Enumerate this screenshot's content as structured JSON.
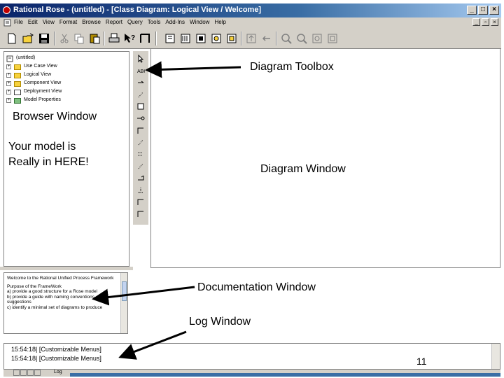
{
  "window": {
    "title": "Rational Rose - (untitled) - [Class Diagram: Logical View / Welcome]",
    "minimize_glyph": "_",
    "maximize_glyph": "□",
    "close_glyph": "×"
  },
  "menubar": {
    "items": [
      "File",
      "Edit",
      "View",
      "Format",
      "Browse",
      "Report",
      "Query",
      "Tools",
      "Add-Ins",
      "Window",
      "Help"
    ],
    "mdi_minimize": "_",
    "mdi_restore": "▫",
    "mdi_close": "×"
  },
  "toolbar": {
    "icons": [
      "new-icon",
      "open-icon",
      "save-icon",
      "cut-icon",
      "copy-icon",
      "paste-icon",
      "print-icon",
      "context-help-icon",
      "browse-class-icon",
      "browse-interaction-icon",
      "browse-component-icon",
      "browse-deployment-icon",
      "browse-parent-icon",
      "browse-previous-icon",
      "zoom-in-icon",
      "zoom-out-icon",
      "fit-window-icon",
      "undo-fit-icon"
    ]
  },
  "browser": {
    "items": [
      {
        "label": "(untitled)",
        "expander": ""
      },
      {
        "label": "Use Case View",
        "expander": "+"
      },
      {
        "label": "Logical View",
        "expander": "+"
      },
      {
        "label": "Component View",
        "expander": "+"
      },
      {
        "label": "Deployment View",
        "expander": "+"
      },
      {
        "label": "Model Properties",
        "expander": "+"
      }
    ]
  },
  "diagram_toolbox": {
    "tools": [
      "selection-arrow-icon",
      "text-box-icon",
      "note-icon",
      "anchor-note-icon",
      "class-icon",
      "interface-icon",
      "unidirectional-association-icon",
      "association-class-icon",
      "package-icon",
      "dependency-icon",
      "generalization-icon",
      "realize-icon",
      "tool-extra-1-icon",
      "tool-extra-2-icon"
    ]
  },
  "documentation": {
    "paragraphs": [
      "Welcome to the Rational Unified Process Framework",
      "Purpose of the FrameWork",
      "a) provide a good structure for a Rose model",
      "b) provide a guide with naming conventions, suggestions",
      "c) identify a minimal set of diagrams to produce"
    ]
  },
  "log": {
    "lines": [
      "15:54:18|  [Customizable Menus]",
      "15:54:18|  [Customizable Menus]"
    ],
    "tab_label": "Log"
  },
  "annotations": {
    "diagram_toolbox": "Diagram Toolbox",
    "browser_window": "Browser Window",
    "model_note_line1": "Your model is",
    "model_note_line2": "Really in HERE!",
    "diagram_window": "Diagram Window",
    "documentation_window": "Documentation Window",
    "log_window": "Log Window",
    "page_number": "11"
  },
  "colors": {
    "titlebar_start": "#0a246a",
    "titlebar_end": "#a6caf0",
    "chrome": "#d4d0c8",
    "folder": "#f7d23e"
  }
}
